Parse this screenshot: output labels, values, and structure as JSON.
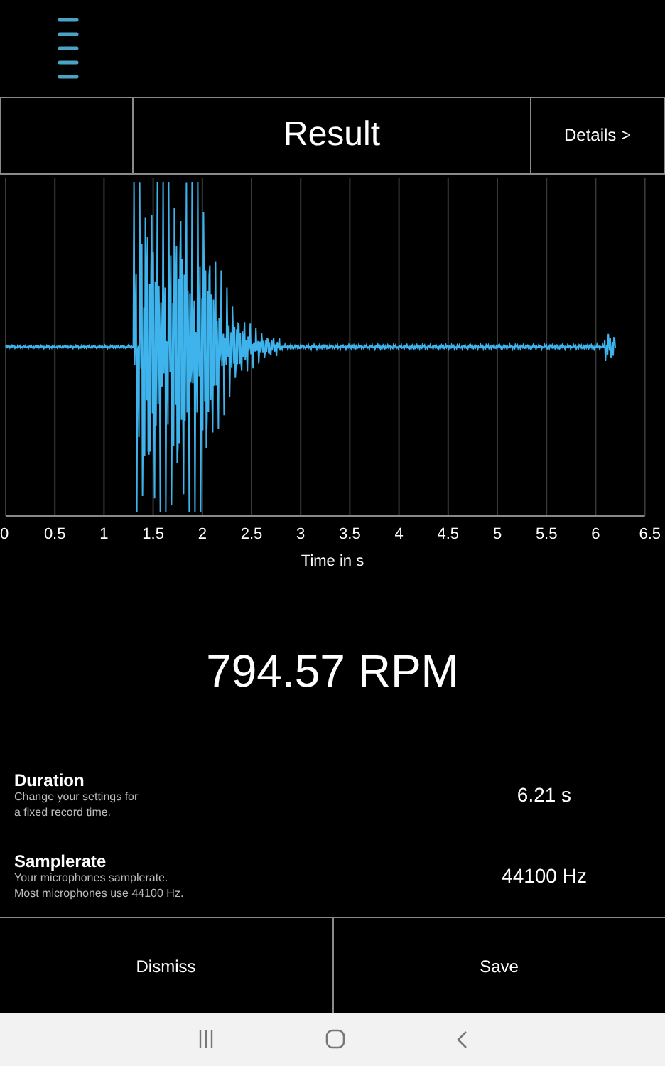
{
  "toolbar": {
    "title": "Result",
    "details": "Details >"
  },
  "chart": {
    "x_ticks": [
      "0",
      "0.5",
      "1",
      "1.5",
      "2",
      "2.5",
      "3",
      "3.5",
      "4",
      "4.5",
      "5",
      "5.5",
      "6",
      "6.5"
    ],
    "xlabel": "Time in s"
  },
  "result": "794.57 RPM",
  "settings": [
    {
      "label": "Duration",
      "description": "Change your settings for\na fixed record time.",
      "value": "6.21 s"
    },
    {
      "label": "Samplerate",
      "description": "Your microphones samplerate.\nMost microphones use 44100 Hz.",
      "value": "44100 Hz"
    }
  ],
  "buttons": [
    "Dismiss",
    "Save"
  ]
}
